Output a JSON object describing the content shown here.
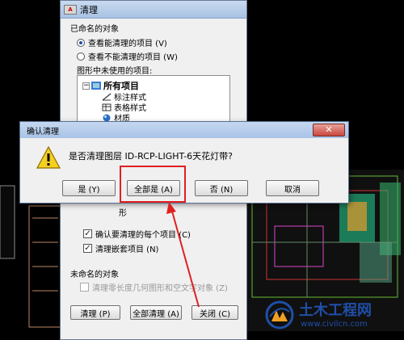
{
  "purge": {
    "title": "清理",
    "named_group": "已命名的对象",
    "radio_view_purgeable": "查看能清理的项目 (V)",
    "radio_view_unpurgeable": "查看不能清理的项目 (W)",
    "unused_label": "图形中未使用的项目:",
    "tree": {
      "root": "所有项目",
      "items": [
        "标注样式",
        "表格样式",
        "材质"
      ]
    },
    "partial_item": "形",
    "confirm_each": "确认要清理的每个项目 (C)",
    "purge_nested": "清理嵌套项目 (N)",
    "unnamed_group": "未命名的对象",
    "purge_zero_geometry": "清理零长度几何图形和空文字对象 (Z)",
    "buttons": {
      "purge": "清理 (P)",
      "purge_all": "全部清理 (A)",
      "close": "关闭 (C)"
    }
  },
  "confirm": {
    "title": "确认清理",
    "message": "是否清理图层 ID-RCP-LIGHT-6天花灯带?",
    "buttons": {
      "yes": "是 (Y)",
      "yes_all": "全部是 (A)",
      "no": "否 (N)",
      "cancel": "取消"
    }
  },
  "watermark": {
    "name": "土木工程网",
    "url": "www.civilcn.com"
  },
  "colors": {
    "highlight": "#e02020",
    "brand": "#1f4fa8"
  }
}
